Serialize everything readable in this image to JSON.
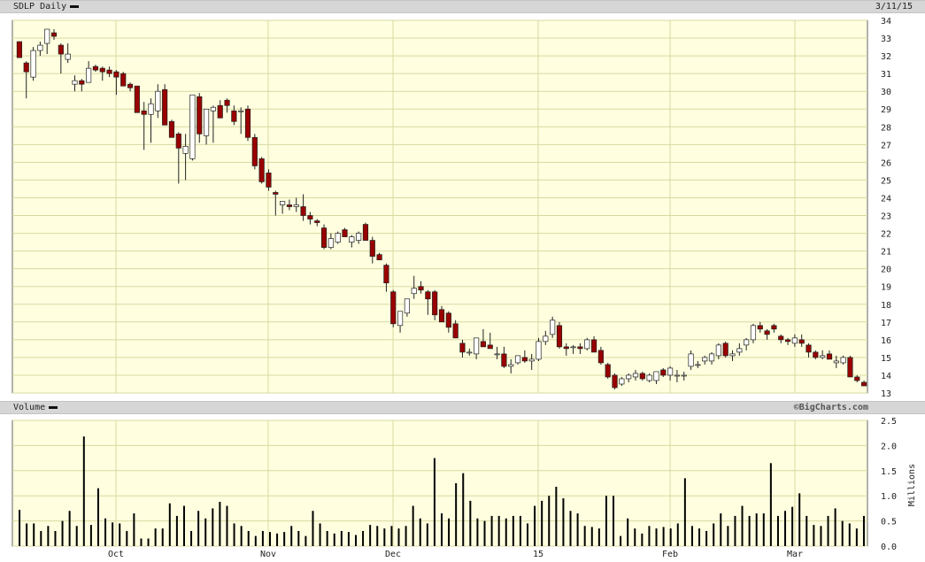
{
  "header": {
    "symbol_label": "SDLP Daily",
    "date": "3/11/15"
  },
  "volume_header": {
    "label": "Volume",
    "credit": "©BigCharts.com"
  },
  "colors": {
    "plot_bg": "#ffffe0",
    "grid": "#d8d8a0",
    "down": "#990000",
    "up": "#ffffff",
    "outline": "#222222",
    "volume_bar": "#000000"
  },
  "chart_data": [
    {
      "type": "candlestick",
      "title": "SDLP Daily",
      "ylim": [
        13,
        34
      ],
      "y_ticks": [
        13,
        14,
        15,
        16,
        17,
        18,
        19,
        20,
        21,
        22,
        23,
        24,
        25,
        26,
        27,
        28,
        29,
        30,
        31,
        32,
        33,
        34
      ],
      "x_ticks": [
        {
          "label": "Oct",
          "index": 14
        },
        {
          "label": "Nov",
          "index": 36
        },
        {
          "label": "Dec",
          "index": 54
        },
        {
          "label": "15",
          "index": 75
        },
        {
          "label": "Feb",
          "index": 94
        },
        {
          "label": "Mar",
          "index": 112
        }
      ],
      "grid": true,
      "ohlc": [
        [
          32.8,
          32.8,
          31.9,
          31.9
        ],
        [
          31.6,
          31.7,
          29.6,
          31.1
        ],
        [
          30.8,
          32.5,
          30.6,
          32.3
        ],
        [
          32.3,
          32.8,
          32.0,
          32.6
        ],
        [
          32.7,
          33.5,
          32.1,
          33.5
        ],
        [
          33.3,
          33.5,
          32.9,
          33.1
        ],
        [
          32.6,
          32.7,
          31.0,
          32.1
        ],
        [
          31.8,
          32.7,
          31.6,
          32.1
        ],
        [
          30.4,
          30.9,
          30.0,
          30.6
        ],
        [
          30.6,
          30.7,
          30.0,
          30.4
        ],
        [
          30.5,
          31.7,
          30.5,
          31.3
        ],
        [
          31.4,
          31.5,
          31.1,
          31.2
        ],
        [
          31.3,
          31.4,
          30.6,
          31.1
        ],
        [
          31.2,
          31.4,
          30.8,
          31.0
        ],
        [
          31.1,
          31.2,
          29.8,
          30.8
        ],
        [
          31.0,
          31.1,
          30.3,
          30.3
        ],
        [
          30.4,
          30.5,
          30.0,
          30.2
        ],
        [
          30.3,
          30.3,
          28.9,
          28.8
        ],
        [
          28.9,
          29.4,
          26.7,
          28.7
        ],
        [
          28.7,
          29.6,
          27.1,
          29.3
        ],
        [
          28.9,
          30.4,
          28.5,
          30.0
        ],
        [
          30.1,
          30.4,
          28.1,
          28.1
        ],
        [
          28.3,
          28.4,
          27.5,
          27.4
        ],
        [
          27.6,
          27.7,
          24.8,
          26.8
        ],
        [
          26.5,
          27.6,
          25.0,
          26.9
        ],
        [
          26.2,
          29.8,
          26.1,
          29.8
        ],
        [
          29.7,
          29.9,
          27.1,
          27.6
        ],
        [
          27.5,
          29.0,
          27.0,
          29.0
        ],
        [
          28.9,
          29.2,
          27.1,
          29.1
        ],
        [
          29.2,
          29.5,
          28.5,
          28.5
        ],
        [
          29.5,
          29.6,
          28.8,
          29.2
        ],
        [
          28.9,
          29.2,
          28.1,
          28.3
        ],
        [
          28.9,
          29.1,
          27.6,
          28.9
        ],
        [
          29.0,
          29.2,
          27.2,
          27.4
        ],
        [
          27.4,
          27.6,
          25.6,
          25.8
        ],
        [
          26.2,
          26.3,
          24.8,
          24.9
        ],
        [
          25.4,
          25.6,
          24.4,
          24.6
        ],
        [
          24.3,
          24.4,
          23.0,
          24.2
        ],
        [
          23.6,
          23.8,
          23.1,
          23.8
        ],
        [
          23.6,
          23.9,
          23.3,
          23.5
        ],
        [
          23.5,
          24.0,
          23.2,
          23.6
        ],
        [
          23.5,
          24.2,
          22.7,
          23.0
        ],
        [
          23.0,
          23.2,
          22.5,
          22.8
        ],
        [
          22.7,
          22.8,
          22.4,
          22.6
        ],
        [
          22.3,
          22.5,
          21.1,
          21.2
        ],
        [
          21.2,
          22.0,
          21.1,
          21.7
        ],
        [
          21.5,
          22.1,
          21.4,
          22.0
        ],
        [
          22.2,
          22.3,
          21.8,
          21.8
        ],
        [
          21.5,
          21.9,
          21.2,
          21.8
        ],
        [
          21.6,
          22.1,
          21.4,
          22.0
        ],
        [
          22.5,
          22.6,
          21.6,
          21.6
        ],
        [
          21.6,
          21.8,
          20.3,
          20.7
        ],
        [
          20.8,
          20.9,
          20.5,
          20.5
        ],
        [
          20.2,
          20.3,
          18.7,
          19.2
        ],
        [
          18.7,
          18.8,
          16.7,
          16.9
        ],
        [
          16.8,
          17.4,
          16.4,
          17.6
        ],
        [
          17.5,
          18.3,
          17.3,
          18.3
        ],
        [
          18.6,
          19.6,
          18.3,
          18.9
        ],
        [
          19.0,
          19.3,
          18.6,
          18.8
        ],
        [
          18.7,
          18.8,
          17.4,
          18.3
        ],
        [
          18.7,
          18.8,
          17.1,
          17.4
        ],
        [
          17.7,
          17.9,
          17.0,
          17.0
        ],
        [
          17.5,
          17.6,
          16.4,
          16.7
        ],
        [
          16.9,
          17.1,
          16.1,
          16.1
        ],
        [
          15.8,
          16.0,
          15.0,
          15.3
        ],
        [
          15.3,
          15.5,
          15.1,
          15.3
        ],
        [
          15.2,
          16.1,
          14.9,
          16.1
        ],
        [
          15.9,
          16.6,
          15.6,
          15.6
        ],
        [
          15.7,
          16.4,
          15.5,
          15.5
        ],
        [
          15.2,
          15.6,
          14.9,
          15.2
        ],
        [
          15.2,
          15.6,
          14.4,
          14.5
        ],
        [
          14.5,
          14.9,
          14.1,
          14.6
        ],
        [
          14.7,
          15.1,
          14.6,
          15.1
        ],
        [
          15.0,
          15.4,
          14.7,
          14.8
        ],
        [
          14.8,
          15.2,
          14.3,
          14.9
        ],
        [
          14.9,
          16.1,
          14.8,
          15.9
        ],
        [
          15.9,
          16.5,
          15.7,
          16.2
        ],
        [
          16.3,
          17.3,
          16.1,
          17.1
        ],
        [
          16.8,
          17.0,
          15.5,
          15.6
        ],
        [
          15.6,
          15.8,
          15.1,
          15.5
        ],
        [
          15.6,
          15.7,
          15.2,
          15.6
        ],
        [
          15.6,
          15.8,
          15.2,
          15.5
        ],
        [
          15.5,
          16.1,
          15.4,
          16.0
        ],
        [
          16.0,
          16.2,
          15.3,
          15.3
        ],
        [
          15.4,
          15.6,
          14.6,
          14.7
        ],
        [
          14.6,
          14.7,
          13.8,
          13.9
        ],
        [
          14.0,
          14.1,
          13.2,
          13.3
        ],
        [
          13.5,
          13.9,
          13.4,
          13.8
        ],
        [
          13.8,
          14.1,
          13.6,
          14.0
        ],
        [
          13.9,
          14.3,
          13.7,
          14.1
        ],
        [
          14.1,
          14.2,
          13.7,
          13.8
        ],
        [
          13.7,
          14.1,
          13.6,
          14.0
        ],
        [
          13.7,
          14.2,
          13.5,
          14.2
        ],
        [
          14.3,
          14.4,
          13.9,
          14.0
        ],
        [
          14.0,
          14.5,
          13.7,
          14.4
        ],
        [
          14.0,
          14.3,
          13.6,
          14.0
        ],
        [
          14.0,
          14.2,
          13.7,
          14.0
        ],
        [
          14.5,
          15.4,
          14.3,
          15.2
        ],
        [
          14.6,
          14.8,
          14.4,
          14.6
        ],
        [
          14.8,
          15.1,
          14.6,
          15.0
        ],
        [
          14.8,
          15.3,
          14.6,
          15.2
        ],
        [
          15.1,
          15.8,
          14.9,
          15.7
        ],
        [
          15.8,
          15.9,
          15.0,
          15.1
        ],
        [
          15.1,
          15.4,
          14.8,
          15.2
        ],
        [
          15.3,
          15.8,
          15.1,
          15.5
        ],
        [
          15.7,
          16.1,
          15.4,
          16.0
        ],
        [
          16.0,
          16.9,
          15.8,
          16.8
        ],
        [
          16.8,
          17.0,
          16.4,
          16.6
        ],
        [
          16.5,
          16.6,
          16.0,
          16.3
        ],
        [
          16.8,
          16.9,
          16.4,
          16.6
        ],
        [
          16.2,
          16.3,
          15.8,
          16.0
        ],
        [
          16.0,
          16.1,
          15.7,
          15.9
        ],
        [
          15.8,
          16.3,
          15.6,
          16.1
        ],
        [
          16.0,
          16.3,
          15.6,
          15.8
        ],
        [
          15.7,
          15.8,
          15.0,
          15.3
        ],
        [
          15.3,
          15.4,
          14.9,
          15.0
        ],
        [
          15.0,
          15.4,
          14.9,
          15.1
        ],
        [
          15.2,
          15.4,
          14.9,
          14.9
        ],
        [
          14.7,
          15.1,
          14.4,
          14.8
        ],
        [
          14.7,
          15.1,
          14.6,
          15.0
        ],
        [
          15.0,
          15.1,
          13.9,
          13.9
        ],
        [
          13.9,
          14.0,
          13.6,
          13.7
        ],
        [
          13.6,
          13.7,
          13.4,
          13.4
        ]
      ]
    },
    {
      "type": "bar",
      "ylabel": "Millions",
      "ylim": [
        0,
        2.5
      ],
      "y_ticks": [
        "0.0",
        "0.5",
        "1.0",
        "1.5",
        "2.0",
        "2.5"
      ],
      "values": [
        0.72,
        0.45,
        0.45,
        0.3,
        0.4,
        0.3,
        0.5,
        0.7,
        0.4,
        2.18,
        0.42,
        1.15,
        0.55,
        0.47,
        0.45,
        0.3,
        0.65,
        0.15,
        0.15,
        0.35,
        0.35,
        0.85,
        0.6,
        0.8,
        0.3,
        0.7,
        0.55,
        0.75,
        0.88,
        0.8,
        0.45,
        0.4,
        0.3,
        0.2,
        0.3,
        0.28,
        0.25,
        0.28,
        0.4,
        0.3,
        0.2,
        0.7,
        0.45,
        0.3,
        0.25,
        0.3,
        0.28,
        0.22,
        0.3,
        0.42,
        0.4,
        0.35,
        0.4,
        0.35,
        0.4,
        0.8,
        0.55,
        0.45,
        1.75,
        0.65,
        0.55,
        1.25,
        1.45,
        0.9,
        0.55,
        0.5,
        0.6,
        0.6,
        0.55,
        0.6,
        0.6,
        0.45,
        0.8,
        0.9,
        1.0,
        1.18,
        0.95,
        0.7,
        0.65,
        0.4,
        0.38,
        0.35,
        1.0,
        1.0,
        0.2,
        0.55,
        0.35,
        0.25,
        0.4,
        0.35,
        0.38,
        0.35,
        0.45,
        1.35,
        0.4,
        0.35,
        0.3,
        0.45,
        0.65,
        0.4,
        0.6,
        0.8,
        0.6,
        0.65,
        0.65,
        1.65,
        0.6,
        0.7,
        0.78,
        1.05,
        0.6,
        0.42,
        0.4,
        0.6,
        0.75,
        0.5,
        0.45,
        0.35,
        0.6
      ]
    }
  ]
}
